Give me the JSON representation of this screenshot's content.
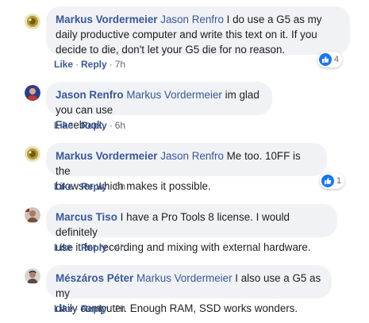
{
  "comments": [
    {
      "author": "Markus Vordermeier",
      "mention": "Jason Renfro",
      "text_lines": [
        " I do use a G5 as my",
        "daily productive computer and write this text on it. If you",
        "decide to die, don't let your G5 die for no reason."
      ],
      "actions": {
        "like": "Like",
        "reply": "Reply",
        "time": "7h"
      },
      "reactions": {
        "icon": "like-icon",
        "count": "4"
      },
      "avatar_color": "#b59a2e"
    },
    {
      "author": "Jason Renfro",
      "mention": "Markus Vordermeier",
      "text_lines": [
        " im glad you can use",
        "Facebook."
      ],
      "actions": {
        "like": "Like",
        "reply": "Reply",
        "time": "6h"
      },
      "avatar_color": "#2d3b8f"
    },
    {
      "author": "Markus Vordermeier",
      "mention": "Jason Renfro",
      "text_lines": [
        " Me too. 10FF is the",
        "browser which makes it possible."
      ],
      "actions": {
        "like": "Like",
        "reply": "Reply",
        "time": "6h"
      },
      "reactions": {
        "icon": "like-icon",
        "count": "1"
      },
      "avatar_color": "#b59a2e"
    },
    {
      "author": "Marcus Tiso",
      "mention": "",
      "text_lines": [
        " I have a Pro Tools 8 license. I would definitely",
        "use it for recording and mixing with external hardware."
      ],
      "actions": {
        "like": "Like",
        "reply": "Reply",
        "time": "4h"
      },
      "avatar_color": "#7a4f3a"
    },
    {
      "author": "Mészáros Péter",
      "mention": "Markus Vordermeier",
      "text_lines": [
        " I also use a G5 as my",
        "daily computer. Enough RAM, SSD works wonders."
      ],
      "actions": {
        "like": "Like",
        "reply": "Reply",
        "time": "2h"
      },
      "avatar_color": "#5b4a44"
    }
  ],
  "separator": "·",
  "colors": {
    "link": "#385898",
    "bubble": "#f0f2f5",
    "text": "#1c1e21",
    "meta": "#606770",
    "like_blue": "#1877f2"
  }
}
